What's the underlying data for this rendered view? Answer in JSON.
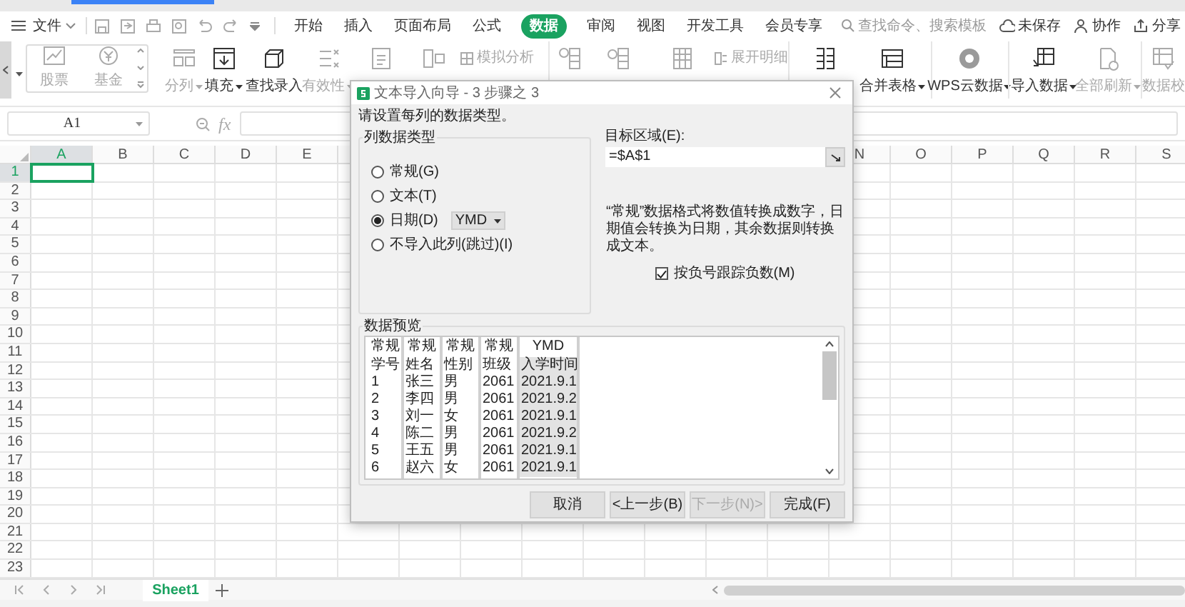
{
  "menu": {
    "file": "文件",
    "tabs": [
      {
        "label": "开始",
        "selected": false
      },
      {
        "label": "插入",
        "selected": false
      },
      {
        "label": "页面布局",
        "selected": false
      },
      {
        "label": "公式",
        "selected": false
      },
      {
        "label": "数据",
        "selected": true
      },
      {
        "label": "审阅",
        "selected": false
      },
      {
        "label": "视图",
        "selected": false
      },
      {
        "label": "开发工具",
        "selected": false
      },
      {
        "label": "会员专享",
        "selected": false
      }
    ],
    "search": {
      "placeholder": "查找命令、搜索模板"
    },
    "actions": [
      "未保存",
      "协作",
      "分享"
    ]
  },
  "ribbon": {
    "group": [
      {
        "label": "股票",
        "disabled": true
      },
      {
        "label": "基金",
        "disabled": true
      }
    ],
    "items": [
      {
        "kind": "large",
        "label": "分列",
        "dropdown": true,
        "disabled": true
      },
      {
        "kind": "large",
        "label": "填充",
        "dropdown": true,
        "disabled": false
      },
      {
        "kind": "large",
        "label": "查找录入",
        "dropdown": false,
        "disabled": false
      },
      {
        "kind": "large",
        "label": "有效性",
        "dropdown": true,
        "disabled": true
      },
      {
        "kind": "large",
        "disabled": true
      },
      {
        "kind": "large",
        "disabled": true
      },
      {
        "kind": "small",
        "label": "模拟分析",
        "disabled": true
      },
      {
        "kind": "separator"
      },
      {
        "kind": "large",
        "disabled": true
      },
      {
        "kind": "large",
        "disabled": true
      },
      {
        "kind": "large",
        "disabled": true
      },
      {
        "kind": "small",
        "label": "展开明细",
        "disabled": true
      },
      {
        "kind": "separator"
      },
      {
        "kind": "large",
        "disabled": false
      },
      {
        "kind": "large",
        "label": "合并表格",
        "dropdown": true,
        "disabled": false
      },
      {
        "kind": "separator"
      },
      {
        "kind": "large",
        "label": "WPS云数据",
        "dropdown": true,
        "disabled": false
      },
      {
        "kind": "separator"
      },
      {
        "kind": "large",
        "label": "导入数据",
        "dropdown": true,
        "disabled": false
      },
      {
        "kind": "large",
        "label": "全部刷新",
        "dropdown": true,
        "disabled": true
      },
      {
        "kind": "separator"
      },
      {
        "kind": "large",
        "label": "数据校",
        "dropdown": false,
        "disabled": true
      }
    ]
  },
  "formula_bar": {
    "name_box": "A1",
    "fx": "fx"
  },
  "grid": {
    "columns_left": [
      {
        "label": "A",
        "selected": true
      },
      {
        "label": "B",
        "selected": false
      },
      {
        "label": "C",
        "selected": false
      },
      {
        "label": "D",
        "selected": false
      },
      {
        "label": "E",
        "selected": false
      }
    ],
    "columns_right": [
      {
        "label": "N",
        "selected": false
      },
      {
        "label": "O",
        "selected": false
      },
      {
        "label": "P",
        "selected": false
      },
      {
        "label": "Q",
        "selected": false
      },
      {
        "label": "R",
        "selected": false
      },
      {
        "label": "S",
        "selected": false
      }
    ],
    "rows": [
      {
        "label": "1",
        "selected": true
      },
      {
        "label": "2",
        "selected": false
      },
      {
        "label": "3",
        "selected": false
      },
      {
        "label": "4",
        "selected": false
      },
      {
        "label": "5",
        "selected": false
      },
      {
        "label": "6",
        "selected": false
      },
      {
        "label": "7",
        "selected": false
      },
      {
        "label": "8",
        "selected": false
      },
      {
        "label": "9",
        "selected": false
      },
      {
        "label": "10",
        "selected": false
      },
      {
        "label": "11",
        "selected": false
      },
      {
        "label": "12",
        "selected": false
      },
      {
        "label": "13",
        "selected": false
      },
      {
        "label": "14",
        "selected": false
      },
      {
        "label": "15",
        "selected": false
      },
      {
        "label": "16",
        "selected": false
      },
      {
        "label": "17",
        "selected": false
      },
      {
        "label": "18",
        "selected": false
      },
      {
        "label": "19",
        "selected": false
      },
      {
        "label": "20",
        "selected": false
      },
      {
        "label": "21",
        "selected": false
      },
      {
        "label": "22",
        "selected": false
      },
      {
        "label": "23",
        "selected": false
      }
    ]
  },
  "dialog": {
    "title": "文本导入向导 - 3 步骤之 3",
    "instruction": "请设置每列的数据类型。",
    "column_type_group": "列数据类型",
    "column_types": [
      {
        "label": "常规(G)",
        "selected": false
      },
      {
        "label": "文本(T)",
        "selected": false
      },
      {
        "label": "日期(D)",
        "selected": true,
        "format": "YMD"
      },
      {
        "label": "不导入此列(跳过)(I)",
        "selected": false
      }
    ],
    "target_label": "目标区域(E):",
    "target_value": "=$A$1",
    "note": "“常规”数据格式将数值转换成数字，日期值会转换为日期，其余数据则转换成文本。",
    "checkbox": {
      "label": "按负号跟踪负数(M)",
      "checked": true
    },
    "preview_label": "数据预览",
    "preview_columns": [
      {
        "type": "常规",
        "selected": false
      },
      {
        "type": "常规",
        "selected": false
      },
      {
        "type": "常规",
        "selected": false
      },
      {
        "type": "常规",
        "selected": false
      },
      {
        "type": "YMD",
        "selected": true
      }
    ],
    "preview_rows": [
      [
        "学号",
        "姓名",
        "性别",
        "班级",
        "入学时间"
      ],
      [
        "1",
        "张三",
        "男",
        "2061",
        "2021.9.1"
      ],
      [
        "2",
        "李四",
        "男",
        "2061",
        "2021.9.2"
      ],
      [
        "3",
        "刘一",
        "女",
        "2061",
        "2021.9.1"
      ],
      [
        "4",
        "陈二",
        "男",
        "2061",
        "2021.9.2"
      ],
      [
        "5",
        "王五",
        "男",
        "2061",
        "2021.9.1"
      ],
      [
        "6",
        "赵六",
        "女",
        "2061",
        "2021.9.1"
      ]
    ],
    "buttons": [
      {
        "label": "取消",
        "disabled": false
      },
      {
        "label": "<上一步(B)",
        "disabled": false
      },
      {
        "label": "下一步(N)>",
        "disabled": true
      },
      {
        "label": "完成(F)",
        "disabled": false
      }
    ]
  },
  "sheets": [
    {
      "label": "Sheet1",
      "selected": true
    }
  ]
}
